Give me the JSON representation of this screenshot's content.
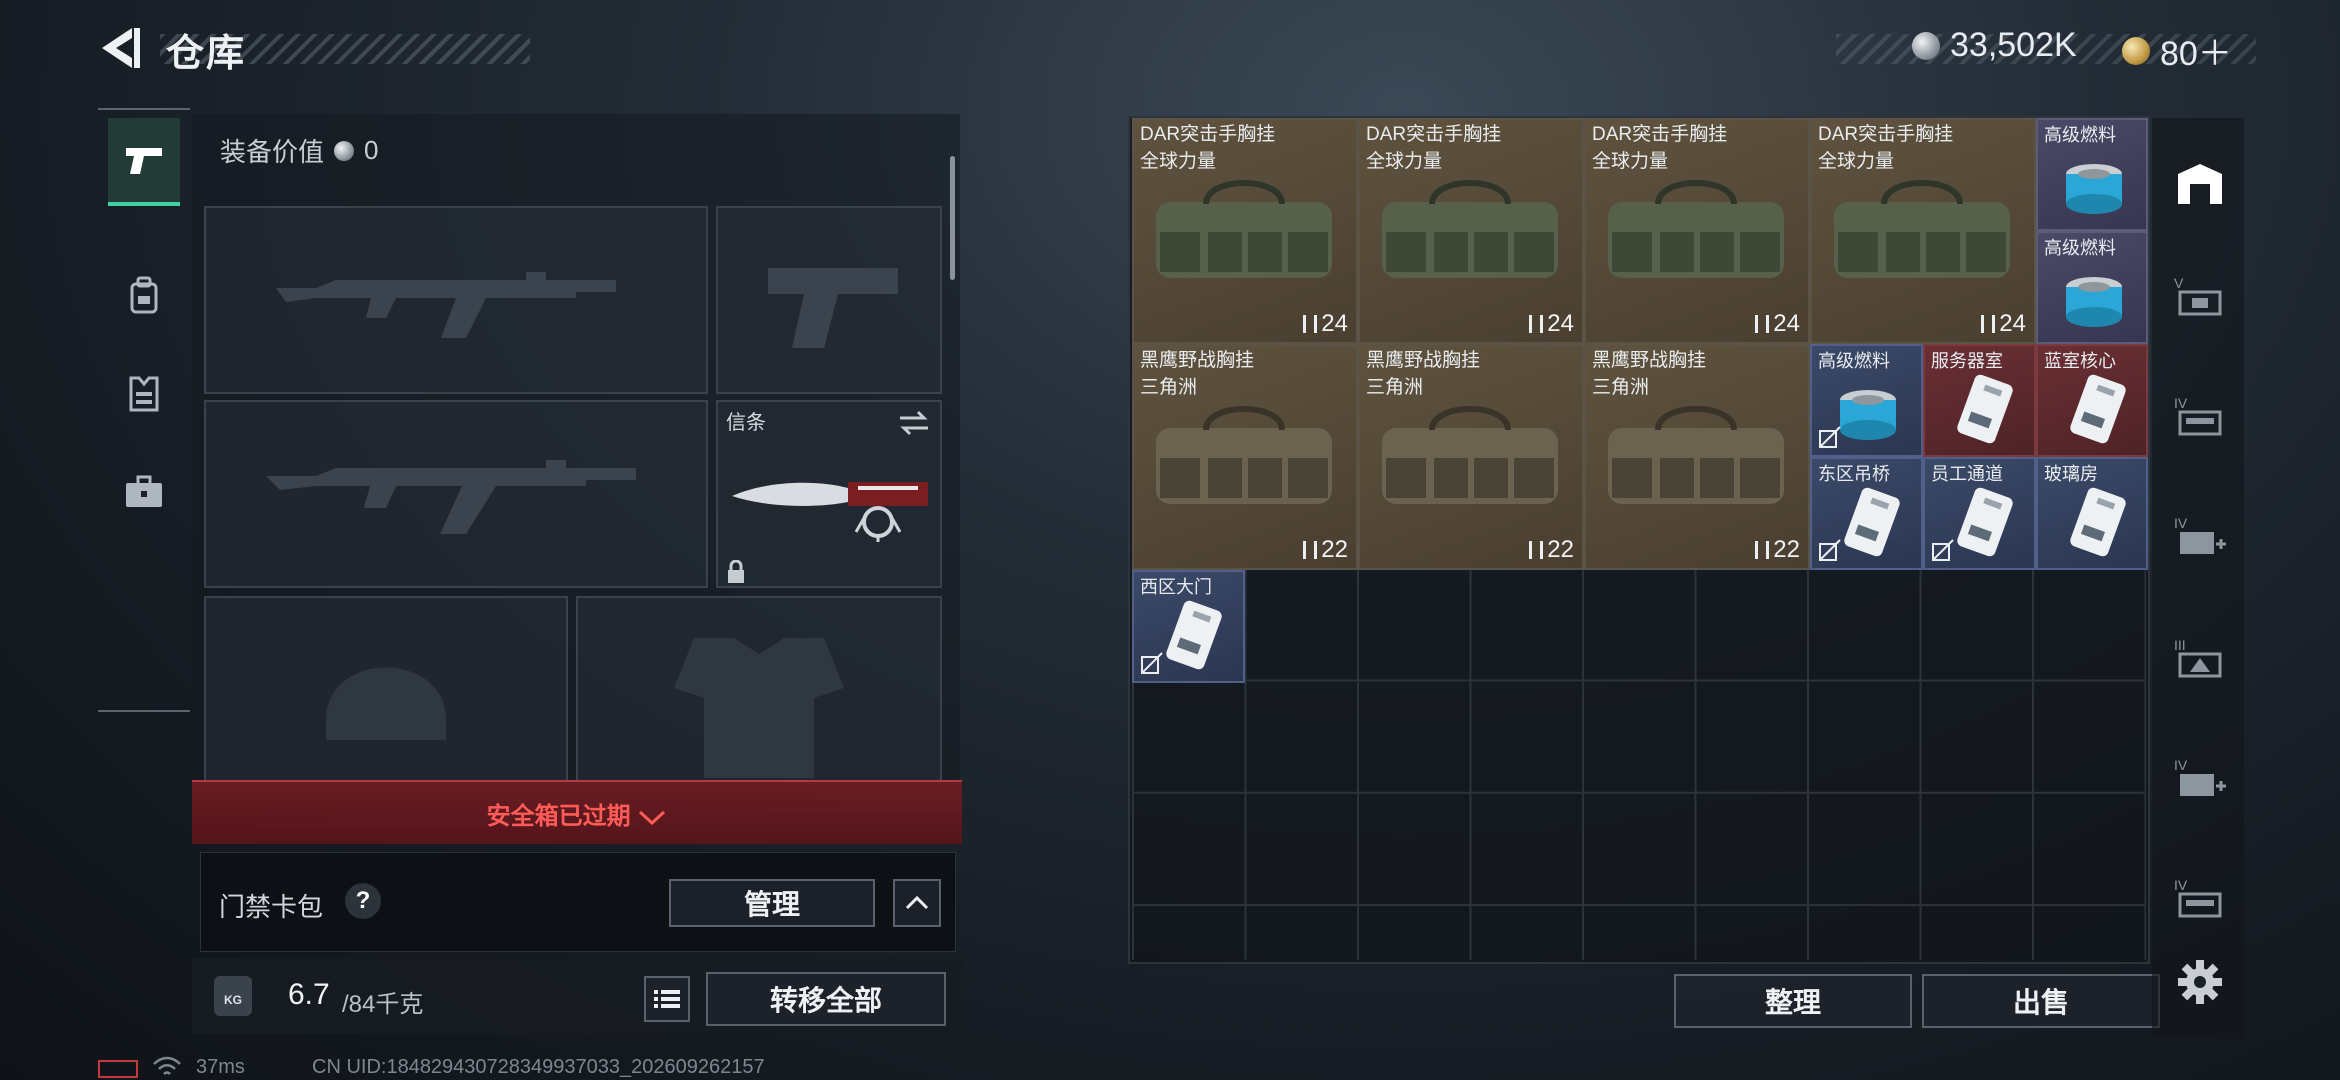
{
  "header": {
    "title": "仓库",
    "currency_silver": "33,502K",
    "currency_gold": "80＋",
    "colors": {
      "accent": "#3fd0a4",
      "warning": "#ff5b57"
    }
  },
  "left_rail": {
    "items": [
      {
        "name": "weapons-tab",
        "icon": "pistol-icon",
        "active": true
      },
      {
        "name": "gear-tab",
        "icon": "backpack-icon",
        "active": false
      },
      {
        "name": "armor-tab",
        "icon": "vest-icon",
        "active": false
      },
      {
        "name": "supplies-tab",
        "icon": "briefcase-icon",
        "active": false
      }
    ]
  },
  "loadout": {
    "equip_value_label": "装备价值",
    "equip_value": "0",
    "token_slot_label": "信条",
    "safe_box_warning": "安全箱已过期",
    "keycard_label": "门禁卡包",
    "keycard_help": "?",
    "manage_button": "管理",
    "weight_current": "6.7",
    "weight_max": "/84千克",
    "transfer_all_button": "转移全部",
    "weight_badge": "KG"
  },
  "storage": {
    "bags_row1": [
      {
        "name": "DAR突击手胸挂",
        "sub": "全球力量",
        "count": "24"
      },
      {
        "name": "DAR突击手胸挂",
        "sub": "全球力量",
        "count": "24"
      },
      {
        "name": "DAR突击手胸挂",
        "sub": "全球力量",
        "count": "24"
      },
      {
        "name": "DAR突击手胸挂",
        "sub": "全球力量",
        "count": "24"
      }
    ],
    "bags_row2": [
      {
        "name": "黑鹰野战胸挂",
        "sub": "三角洲",
        "count": "22"
      },
      {
        "name": "黑鹰野战胸挂",
        "sub": "三角洲",
        "count": "22"
      },
      {
        "name": "黑鹰野战胸挂",
        "sub": "三角洲",
        "count": "22"
      }
    ],
    "small_items": [
      {
        "name": "高级燃料",
        "type": "fuel-can"
      },
      {
        "name": "高级燃料",
        "type": "fuel-can"
      },
      {
        "name": "高级燃料",
        "type": "fuel-can"
      },
      {
        "name": "服务器室",
        "type": "keycard"
      },
      {
        "name": "蓝室核心",
        "type": "keycard"
      },
      {
        "name": "东区吊桥",
        "type": "keycard"
      },
      {
        "name": "员工通道",
        "type": "keycard"
      },
      {
        "name": "玻璃房",
        "type": "keycard"
      },
      {
        "name": "西区大门",
        "type": "keycard"
      }
    ],
    "sort_button": "整理",
    "sell_button": "出售"
  },
  "right_rail": {
    "items": [
      {
        "icon": "warehouse-icon",
        "tier": ""
      },
      {
        "icon": "container-v-icon",
        "tier": "V"
      },
      {
        "icon": "container-iv-icon",
        "tier": "IV"
      },
      {
        "icon": "container-iv-plus-icon",
        "tier": "IV"
      },
      {
        "icon": "container-iii-icon",
        "tier": "III"
      },
      {
        "icon": "container-iv-plus-icon",
        "tier": "IV"
      },
      {
        "icon": "container-iv-icon",
        "tier": "IV"
      }
    ]
  },
  "status_bar": {
    "ping": "37ms",
    "uid": "CN UID:184829430728349937033_202609262157"
  }
}
